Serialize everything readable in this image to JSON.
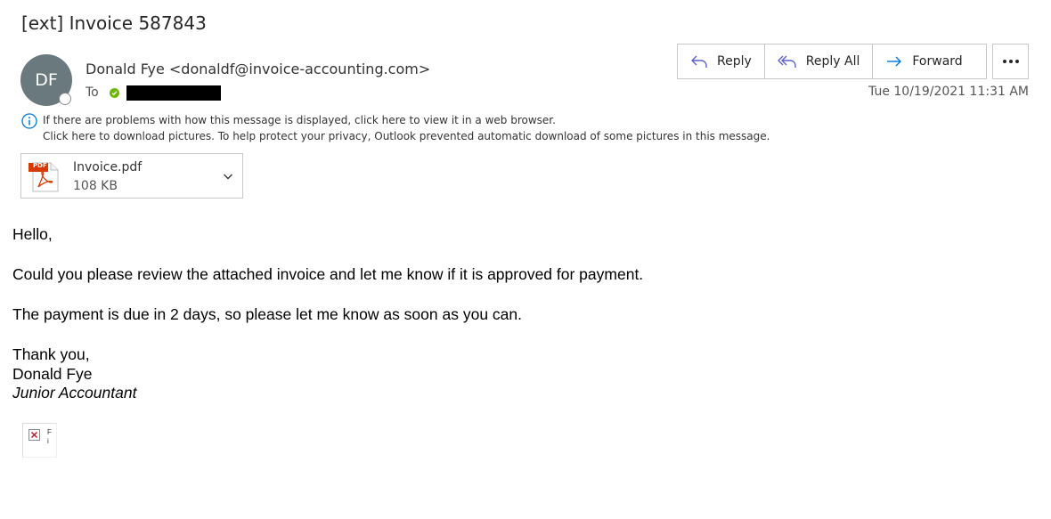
{
  "message": {
    "subject": "[ext] Invoice 587843",
    "sender": {
      "initials": "DF",
      "display": "Donald Fye <donaldf@invoice-accounting.com>",
      "avatar_color": "#69797e"
    },
    "to_label": "To",
    "timestamp": "Tue 10/19/2021 11:31 AM"
  },
  "toolbar": {
    "reply": "Reply",
    "reply_all": "Reply All",
    "forward": "Forward",
    "more_icon": "ellipsis-icon"
  },
  "notices": {
    "line1": "If there are problems with how this message is displayed, click here to view it in a web browser.",
    "line2": "Click here to download pictures. To help protect your privacy, Outlook prevented automatic download of some pictures in this message."
  },
  "attachment": {
    "icon": "pdf-icon",
    "icon_label": "PDF",
    "name": "Invoice.pdf",
    "size": "108 KB"
  },
  "body": {
    "greeting": "Hello,",
    "paragraph1": "Could you please review the attached invoice and let me know if it is approved for payment.",
    "paragraph2": "The payment is due in 2 days, so please let me know as soon as you can.",
    "closing": "Thank you,",
    "signature_name": "Donald Fye",
    "signature_title": "Junior Accountant",
    "broken_image_alt_1": "F",
    "broken_image_alt_2": "i"
  },
  "colors": {
    "accent": "#0078d4",
    "presence_green": "#6bb700",
    "pdf_red": "#d83b01"
  }
}
